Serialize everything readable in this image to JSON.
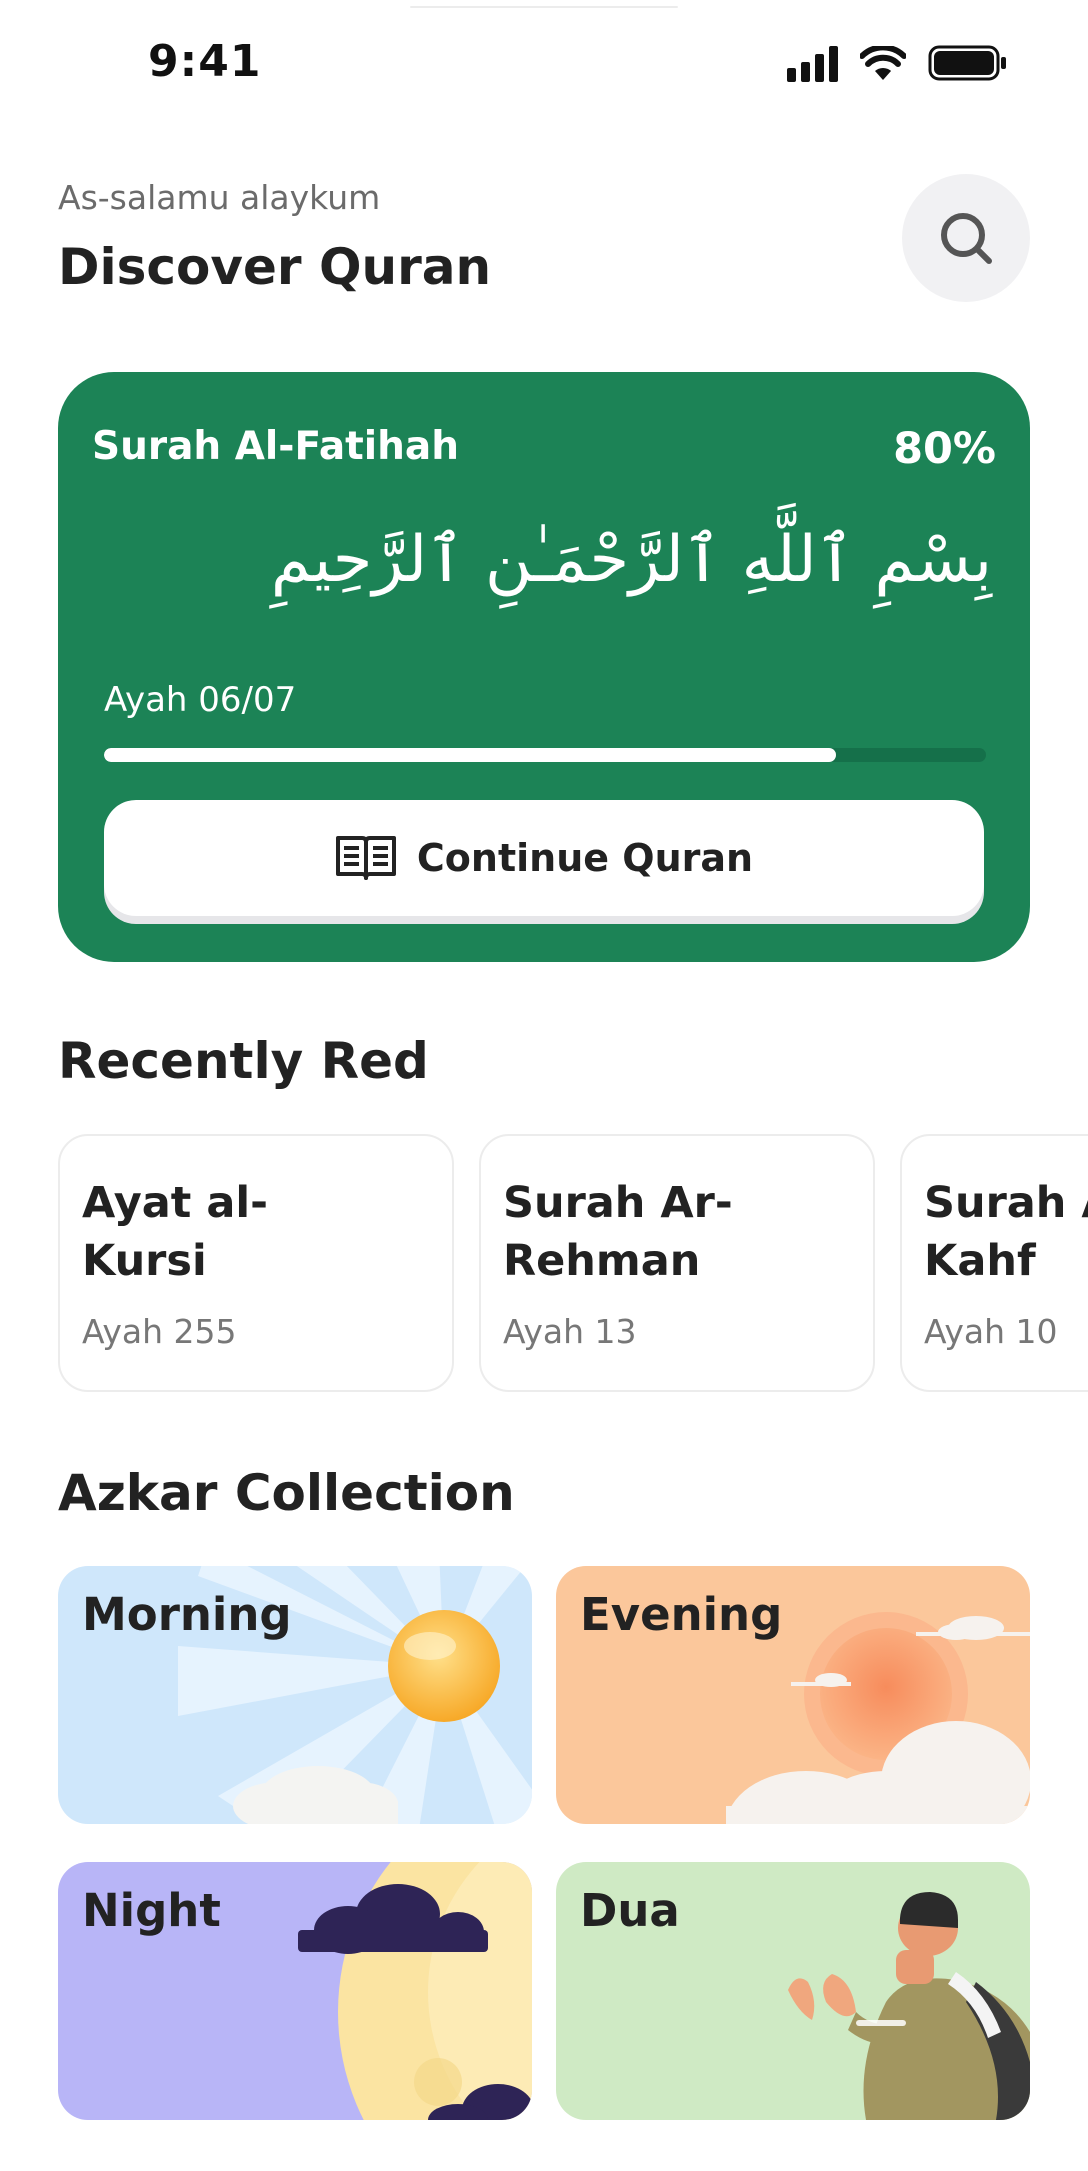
{
  "status_bar": {
    "time": "9:41"
  },
  "header": {
    "greeting": "As-salamu alaykum",
    "title": "Discover Quran"
  },
  "current_reading": {
    "surah": "Surah Al-Fatihah",
    "progress_label": "80%",
    "progress_fraction": 0.83,
    "arabic_text": "بِسْمِ ٱللَّهِ ٱلرَّحْمَـٰنِ ٱلرَّحِيمِ",
    "ayah_label": "Ayah 06/07",
    "continue_label": "Continue Quran"
  },
  "recently_read": {
    "title": "Recently Red",
    "items": [
      {
        "name": "Ayat al-\nKursi",
        "ayah": "Ayah 255"
      },
      {
        "name": "Surah Ar-\nRehman",
        "ayah": "Ayah 13"
      },
      {
        "name": "Surah Al-\nKahf",
        "ayah": "Ayah 10"
      }
    ]
  },
  "azkar": {
    "title": "Azkar Collection",
    "items": [
      {
        "label": "Morning",
        "color": "#cfe7fb"
      },
      {
        "label": "Evening",
        "color": "#fbc79b"
      },
      {
        "label": "Night",
        "color": "#b8b5f7"
      },
      {
        "label": "Dua",
        "color": "#cfeac4"
      }
    ]
  },
  "colors": {
    "primary": "#1c8356",
    "progress_track": "#15704a"
  },
  "icons": [
    "signal-icon",
    "wifi-icon",
    "battery-icon",
    "search-icon",
    "book-icon"
  ]
}
